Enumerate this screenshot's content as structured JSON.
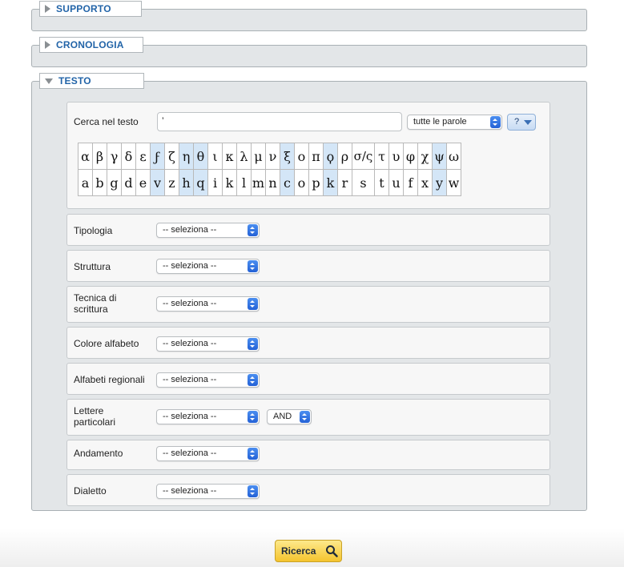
{
  "sections": {
    "supporto": "SUPPORTO",
    "cronologia": "CRONOLOGIA",
    "testo": "TESTO"
  },
  "search": {
    "label": "Cerca nel testo",
    "value": "’",
    "mode": "tutte le parole",
    "help": "?"
  },
  "greek_keys": [
    {
      "c": "α",
      "hl": false
    },
    {
      "c": "β",
      "hl": false
    },
    {
      "c": "γ",
      "hl": false
    },
    {
      "c": "δ",
      "hl": false
    },
    {
      "c": "ε",
      "hl": false
    },
    {
      "c": "ϝ",
      "hl": true
    },
    {
      "c": "ζ",
      "hl": false
    },
    {
      "c": "η",
      "hl": true
    },
    {
      "c": "θ",
      "hl": true
    },
    {
      "c": "ι",
      "hl": false
    },
    {
      "c": "κ",
      "hl": false
    },
    {
      "c": "λ",
      "hl": false
    },
    {
      "c": "μ",
      "hl": false
    },
    {
      "c": "ν",
      "hl": false
    },
    {
      "c": "ξ",
      "hl": true
    },
    {
      "c": "ο",
      "hl": false
    },
    {
      "c": "π",
      "hl": false
    },
    {
      "c": "ϙ",
      "hl": true
    },
    {
      "c": "ρ",
      "hl": false
    },
    {
      "c": "σ/ς",
      "hl": false
    },
    {
      "c": "τ",
      "hl": false
    },
    {
      "c": "υ",
      "hl": false
    },
    {
      "c": "φ",
      "hl": false
    },
    {
      "c": "χ",
      "hl": false
    },
    {
      "c": "ψ",
      "hl": true
    },
    {
      "c": "ω",
      "hl": false
    }
  ],
  "latin_keys": [
    {
      "c": "a",
      "hl": false
    },
    {
      "c": "b",
      "hl": false
    },
    {
      "c": "g",
      "hl": false
    },
    {
      "c": "d",
      "hl": false
    },
    {
      "c": "e",
      "hl": false
    },
    {
      "c": "v",
      "hl": true
    },
    {
      "c": "z",
      "hl": false
    },
    {
      "c": "h",
      "hl": true
    },
    {
      "c": "q",
      "hl": true
    },
    {
      "c": "i",
      "hl": false
    },
    {
      "c": "k",
      "hl": false
    },
    {
      "c": "l",
      "hl": false
    },
    {
      "c": "m",
      "hl": false
    },
    {
      "c": "n",
      "hl": false
    },
    {
      "c": "c",
      "hl": true
    },
    {
      "c": "o",
      "hl": false
    },
    {
      "c": "p",
      "hl": false
    },
    {
      "c": "k",
      "hl": true
    },
    {
      "c": "r",
      "hl": false
    },
    {
      "c": "s",
      "hl": false
    },
    {
      "c": "t",
      "hl": false
    },
    {
      "c": "u",
      "hl": false
    },
    {
      "c": "f",
      "hl": false
    },
    {
      "c": "x",
      "hl": false
    },
    {
      "c": "y",
      "hl": true
    },
    {
      "c": "w",
      "hl": false
    }
  ],
  "fields": {
    "tipologia": {
      "label": "Tipologia",
      "value": "-- seleziona --"
    },
    "struttura": {
      "label": "Struttura",
      "value": "-- seleziona --"
    },
    "tecnica": {
      "label": "Tecnica di scrittura",
      "value": "-- seleziona --"
    },
    "colore": {
      "label": "Colore alfabeto",
      "value": "-- seleziona --"
    },
    "alfabeti": {
      "label": "Alfabeti regionali",
      "value": "-- seleziona --"
    },
    "lettere": {
      "label": "Lettere particolari",
      "value": "-- seleziona --",
      "op": "AND"
    },
    "andamento": {
      "label": "Andamento",
      "value": "-- seleziona --"
    },
    "dialetto": {
      "label": "Dialetto",
      "value": "-- seleziona --"
    }
  },
  "submit": {
    "label": "Ricerca"
  }
}
